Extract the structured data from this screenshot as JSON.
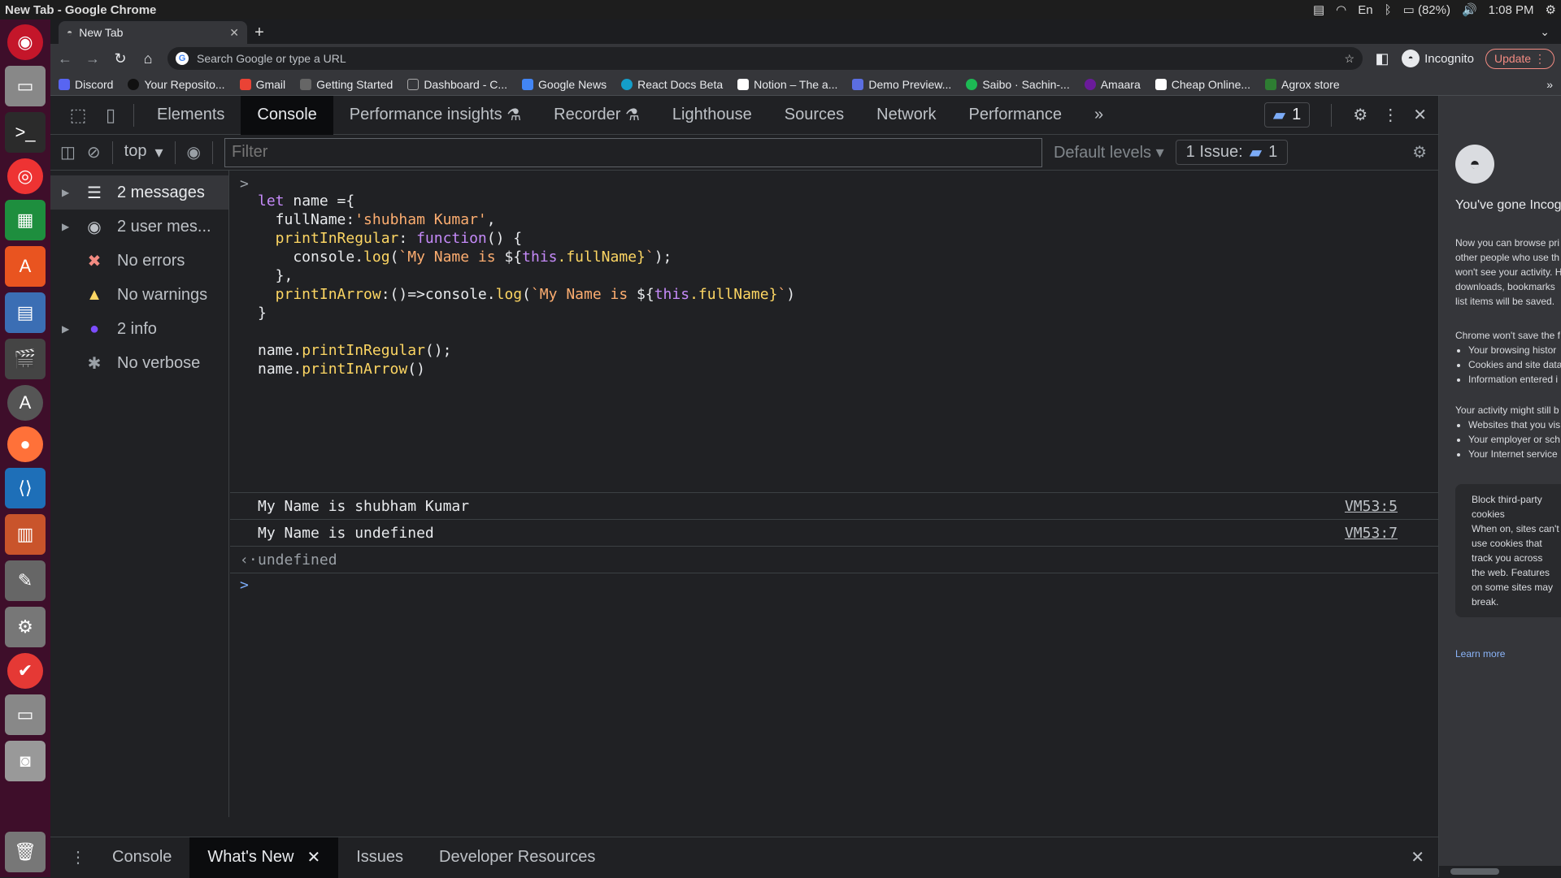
{
  "system": {
    "window_title": "New Tab - Google Chrome",
    "keyboard": "En",
    "battery": "(82%)",
    "clock": "1:08 PM"
  },
  "browser": {
    "tab_title": "New Tab",
    "omnibox_placeholder": "Search Google or type a URL",
    "profile_label": "Incognito",
    "update_label": "Update",
    "bookmarks": [
      "Discord",
      "Your Reposito...",
      "Gmail",
      "Getting Started",
      "Dashboard - C...",
      "Google News",
      "React Docs Beta",
      "Notion – The a...",
      "Demo Preview...",
      "Saibo · Sachin-...",
      "Amaara",
      "Cheap Online...",
      "Agrox store"
    ]
  },
  "devtools": {
    "tabs": [
      "Elements",
      "Console",
      "Performance insights",
      "Recorder",
      "Lighthouse",
      "Sources",
      "Network",
      "Performance"
    ],
    "issues_count": "1",
    "context": "top",
    "filter_placeholder": "Filter",
    "default_levels": "Default levels",
    "issues_label": "1 Issue:",
    "issues_badge": "1",
    "sidebar": [
      {
        "label": "2 messages"
      },
      {
        "label": "2 user mes..."
      },
      {
        "label": "No errors"
      },
      {
        "label": "No warnings"
      },
      {
        "label": "2 info"
      },
      {
        "label": "No verbose"
      }
    ],
    "code": {
      "l1_kw": "let",
      "l1_rest": " name ={",
      "l2_prop": "  fullName:",
      "l2_str": "'shubham Kumar'",
      "l2_end": ",",
      "l3_fn": "  printInRegular",
      "l3_colon": ": ",
      "l3_kw": "function",
      "l3_end": "() {",
      "l4_a": "    console.",
      "l4_fn": "log",
      "l4_b": "(",
      "l4_str1": "`My Name is ",
      "l4_tpl": "${",
      "l4_this": "this",
      "l4_prop": ".fullName}",
      "l4_str2": "`",
      "l4_end": ");",
      "l5": "  },",
      "l6_fn": "  printInArrow",
      "l6_a": ":()=>console.",
      "l6_log": "log",
      "l6_b": "(",
      "l6_str1": "`My Name is ",
      "l6_tpl": "${",
      "l6_this": "this",
      "l6_prop": ".fullName}",
      "l6_str2": "`",
      "l6_end": ")",
      "l7": "}",
      "l9_a": "name.",
      "l9_fn": "printInRegular",
      "l9_end": "();",
      "l10_a": "name.",
      "l10_fn": "printInArrow",
      "l10_end": "()"
    },
    "logs": [
      {
        "text": "My Name is shubham Kumar",
        "source": "VM53:5"
      },
      {
        "text": "My Name is undefined",
        "source": "VM53:7"
      }
    ],
    "result": "undefined",
    "drawer_tabs": [
      "Console",
      "What's New",
      "Issues",
      "Developer Resources"
    ]
  },
  "incognito_page": {
    "heading": "You've gone Incog",
    "p1": [
      "Now you can browse pri",
      "other people who use th",
      "won't see your activity. H",
      "downloads, bookmarks",
      "list items will be saved."
    ],
    "p2": "Chrome won't save the f",
    "list1": [
      "Your browsing histor",
      "Cookies and site data",
      "Information entered i"
    ],
    "p3": "Your activity might still b",
    "list2": [
      "Websites that you vis",
      "Your employer or sch",
      "Your Internet service"
    ],
    "card_title": [
      "Block third-party",
      "cookies"
    ],
    "card_body": [
      "When on, sites can't",
      "use cookies that",
      "track you across",
      "the web. Features",
      "on some sites may",
      "break."
    ],
    "learn_more": "Learn more"
  },
  "colors": {
    "launcher": "#3e0e2a",
    "console_keyword": "#c58af9",
    "console_string": "#fcad70",
    "console_function": "#fdd663",
    "issue_blue": "#7cacf8"
  }
}
